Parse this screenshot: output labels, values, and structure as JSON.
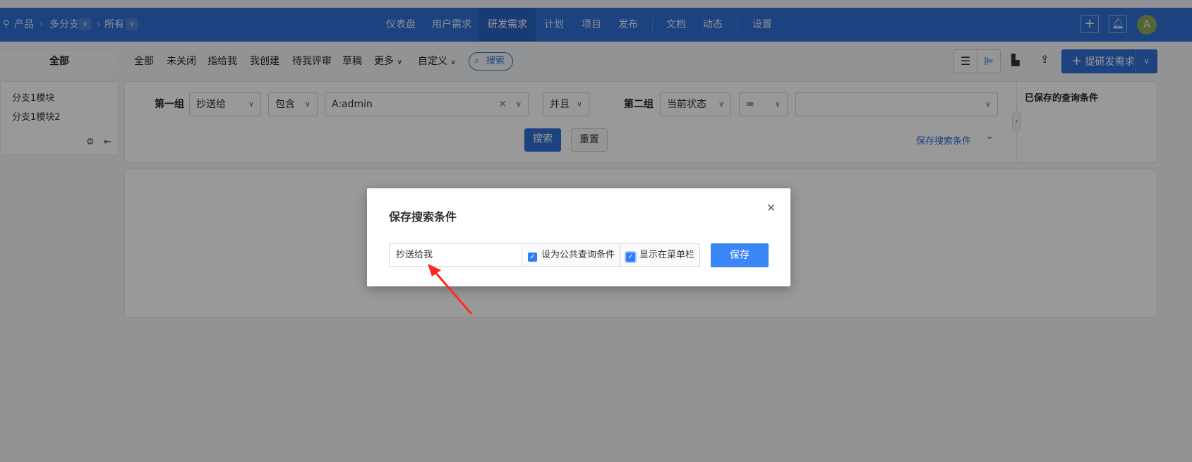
{
  "header": {
    "breadcrumb": [
      "产品",
      "多分支",
      "所有"
    ],
    "nav": [
      "仪表盘",
      "用户需求",
      "研发需求",
      "计划",
      "项目",
      "发布",
      "文档",
      "动态",
      "设置"
    ],
    "active_nav": "研发需求",
    "avatar": "A"
  },
  "subnav": {
    "all_tab": "全部",
    "items": [
      "全部",
      "未关闭",
      "指给我",
      "我创建",
      "待我评审",
      "草稿",
      "更多",
      "自定义"
    ],
    "search": "搜索",
    "create_button": "提研发需求"
  },
  "sidebar": {
    "modules": [
      "分支1模块",
      "分支1模块2"
    ]
  },
  "filter": {
    "group1_label": "第一组",
    "group1_field": "抄送给",
    "group1_op": "包含",
    "group1_value": "A:admin",
    "logic": "并且",
    "group2_label": "第二组",
    "group2_field": "当前状态",
    "group2_op": "=",
    "group2_value": "",
    "search_button": "搜索",
    "reset_button": "重置",
    "save_link": "保存搜索条件"
  },
  "saved_panel": {
    "title": "已保存的查询条件"
  },
  "modal": {
    "title": "保存搜索条件",
    "name_value": "抄送给我",
    "public_label": "设为公共查询条件",
    "public_checked": true,
    "menu_label": "显示在菜单栏",
    "menu_checked": true,
    "save_button": "保存"
  },
  "colors": {
    "brand": "#2f6fd4",
    "primary_button": "#3b86f7",
    "annotation_arrow": "#ff2a1a"
  }
}
